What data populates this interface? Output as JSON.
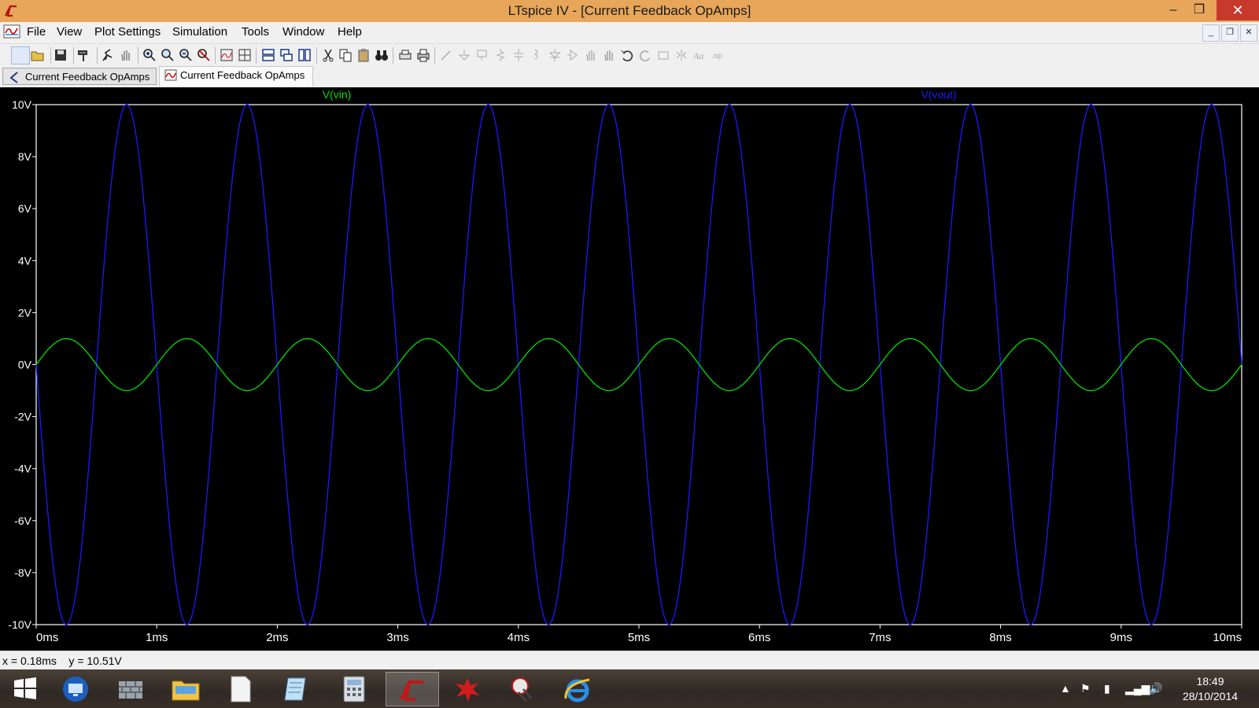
{
  "window": {
    "title": "LTspice IV - [Current Feedback OpAmps]",
    "minimize": "–",
    "maximize": "❐",
    "close": "✕"
  },
  "menu": {
    "items": [
      "File",
      "View",
      "Plot Settings",
      "Simulation",
      "Tools",
      "Window",
      "Help"
    ],
    "mdi_minimize": "_",
    "mdi_restore": "❐",
    "mdi_close": "✕"
  },
  "tabs": [
    {
      "label": "Current Feedback OpAmps",
      "icon": "schematic-icon"
    },
    {
      "label": "Current Feedback OpAmps",
      "icon": "waveform-icon"
    }
  ],
  "colors": {
    "vin": "#00e000",
    "vout": "#1a1aff",
    "axis": "#ffffff",
    "background": "#000000"
  },
  "chart_data": {
    "type": "line",
    "title": "",
    "xlabel": "",
    "ylabel": "",
    "xlim": [
      0,
      10
    ],
    "ylim": [
      -10,
      10
    ],
    "x_unit": "ms",
    "y_unit": "V",
    "x_ticks": [
      "0ms",
      "1ms",
      "2ms",
      "3ms",
      "4ms",
      "5ms",
      "6ms",
      "7ms",
      "8ms",
      "9ms",
      "10ms"
    ],
    "y_ticks": [
      "10V",
      "8V",
      "6V",
      "4V",
      "2V",
      "0V",
      "-2V",
      "-4V",
      "-6V",
      "-8V",
      "-10V"
    ],
    "grid": false,
    "series": [
      {
        "name": "V(vin)",
        "amplitude": 1,
        "frequency_khz": 1,
        "phase": "in-phase",
        "offset": 0
      },
      {
        "name": "V(vout)",
        "amplitude": 10,
        "frequency_khz": 1,
        "phase": "inverted",
        "offset": 0
      }
    ]
  },
  "status": {
    "cursor": "x = 0.18ms    y = 10.51V"
  },
  "taskbar": {
    "apps": [
      "start-icon",
      "remote-desktop-icon",
      "firewall-icon",
      "file-explorer-icon",
      "document-icon",
      "notepad-icon",
      "calculator-icon",
      "ltspice-icon",
      "paint-splat-icon",
      "snipping-tool-icon",
      "internet-explorer-icon"
    ],
    "active_app": "ltspice-icon",
    "clock_time": "18:49",
    "clock_date": "28/10/2014"
  }
}
